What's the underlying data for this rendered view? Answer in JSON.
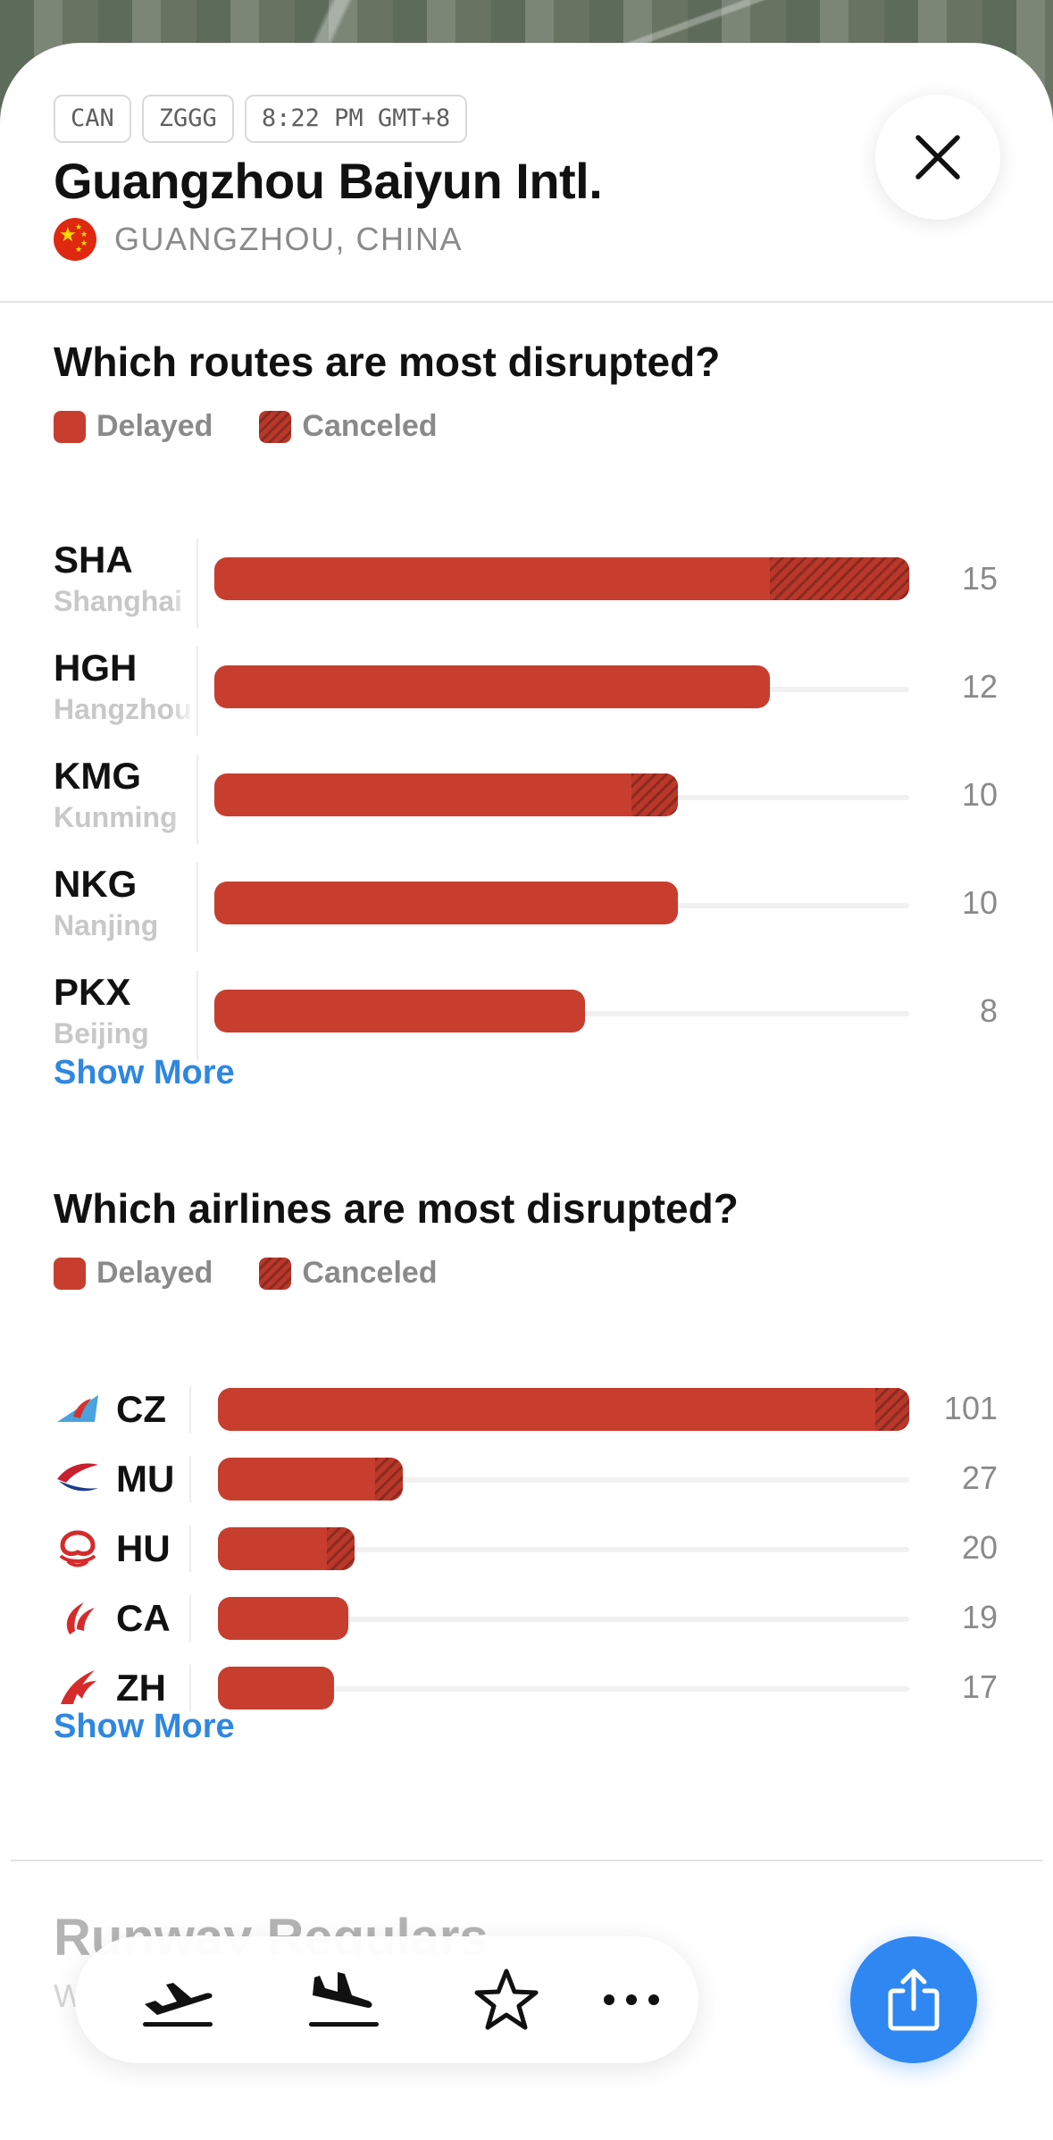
{
  "header": {
    "chips": [
      "CAN",
      "ZGGG",
      "8:22 PM GMT+8"
    ],
    "title": "Guangzhou Baiyun Intl.",
    "location": "GUANGZHOU, CHINA"
  },
  "legend": {
    "delayed": "Delayed",
    "canceled": "Canceled"
  },
  "colors": {
    "delayed": "#c73e2e",
    "canceled": "#8c2a1f",
    "link": "#2f87e0",
    "share": "#2f87f2"
  },
  "routes": {
    "title": "Which routes are most disrupted?",
    "items": [
      {
        "code": "SHA",
        "city": "Shanghai",
        "delayed": 12,
        "canceled": 3,
        "total": "15"
      },
      {
        "code": "HGH",
        "city": "Hangzhou",
        "delayed": 12,
        "canceled": 0,
        "total": "12"
      },
      {
        "code": "KMG",
        "city": "Kunming",
        "delayed": 9,
        "canceled": 1,
        "total": "10"
      },
      {
        "code": "NKG",
        "city": "Nanjing",
        "delayed": 10,
        "canceled": 0,
        "total": "10"
      },
      {
        "code": "PKX",
        "city": "Beijing",
        "delayed": 8,
        "canceled": 0,
        "total": "8"
      }
    ],
    "max": 15,
    "show_more": "Show More"
  },
  "airlines": {
    "title": "Which airlines are most disrupted?",
    "items": [
      {
        "code": "CZ",
        "logo": "china-southern-logo",
        "delayed": 96,
        "canceled": 5,
        "total": "101"
      },
      {
        "code": "MU",
        "logo": "china-eastern-logo",
        "delayed": 23,
        "canceled": 4,
        "total": "27"
      },
      {
        "code": "HU",
        "logo": "hainan-airlines-logo",
        "delayed": 16,
        "canceled": 4,
        "total": "20"
      },
      {
        "code": "CA",
        "logo": "air-china-logo",
        "delayed": 19,
        "canceled": 0,
        "total": "19"
      },
      {
        "code": "ZH",
        "logo": "shenzhen-airlines-logo",
        "delayed": 17,
        "canceled": 0,
        "total": "17"
      }
    ],
    "max": 101,
    "show_more": "Show More"
  },
  "runway": {
    "title": "Runway Regulars",
    "subtitle": "W"
  },
  "toolbar": {
    "icons": [
      "departures-icon",
      "arrivals-icon",
      "star-icon",
      "more-icon"
    ],
    "share_icon": "share-icon",
    "close_icon": "close-icon"
  }
}
